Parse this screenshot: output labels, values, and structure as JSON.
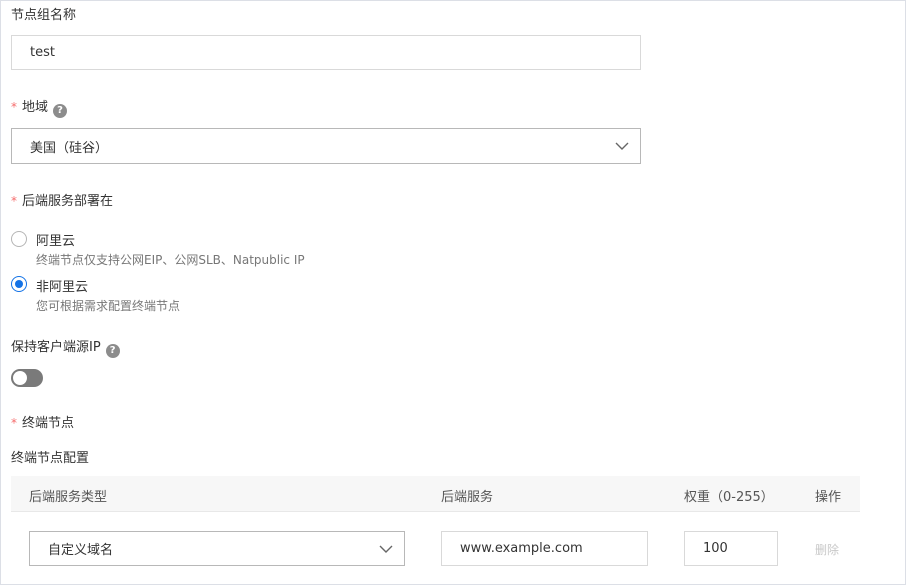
{
  "node_group_name": {
    "label": "节点组名称",
    "value": "test"
  },
  "region": {
    "label": "地域",
    "value": "美国（硅谷）"
  },
  "backend_deploy": {
    "label": "后端服务部署在",
    "options": [
      {
        "title": "阿里云",
        "desc": "终端节点仅支持公网EIP、公网SLB、Natpublic IP",
        "selected": false
      },
      {
        "title": "非阿里云",
        "desc": "您可根据需求配置终端节点",
        "selected": true
      }
    ]
  },
  "keep_client_ip": {
    "label": "保持客户端源IP",
    "enabled": false
  },
  "endpoints": {
    "label": "终端节点",
    "config_label": "终端节点配置",
    "columns": [
      "后端服务类型",
      "后端服务",
      "权重（0-255）",
      "操作"
    ],
    "rows": [
      {
        "type": "自定义域名",
        "service": "www.example.com",
        "weight": "100",
        "action": "删除"
      }
    ]
  },
  "required_mark": "*",
  "help_glyph": "?",
  "colors": {
    "accent": "#1473e6",
    "required": "#f56c6c",
    "switch_off": "#7a7a7a"
  }
}
